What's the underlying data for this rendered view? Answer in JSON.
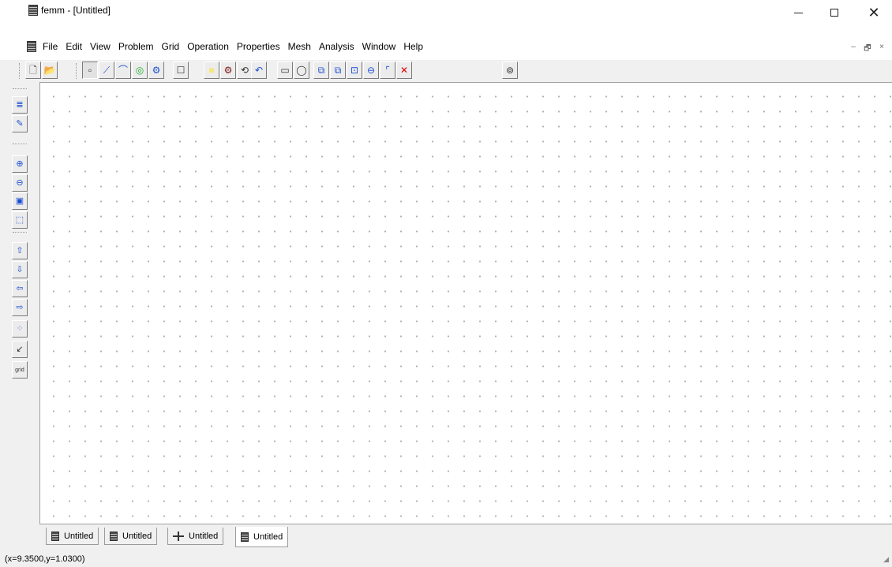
{
  "window": {
    "title": "femm - [Untitled]"
  },
  "titlebar": {
    "minimize": "−",
    "maximize": "□",
    "close": "✕"
  },
  "menu": {
    "items": [
      "File",
      "Edit",
      "View",
      "Problem",
      "Grid",
      "Operation",
      "Properties",
      "Mesh",
      "Analysis",
      "Window",
      "Help"
    ],
    "mdi_controls": [
      "–",
      "🗗",
      "×"
    ]
  },
  "toolbar": {
    "buttons": [
      {
        "name": "new-file-icon",
        "glyph": "🗋",
        "color": "#333333"
      },
      {
        "name": "open-folder-icon",
        "glyph": "📂",
        "color": "#b08000"
      },
      {
        "name": "node-mode-icon",
        "glyph": "▫",
        "color": "#333333",
        "pressed": true
      },
      {
        "name": "segment-mode-icon",
        "glyph": "⟋",
        "color": "#1c4fd0"
      },
      {
        "name": "arc-mode-icon",
        "glyph": "⌒",
        "color": "#1c4fd0"
      },
      {
        "name": "block-label-mode-icon",
        "glyph": "◎",
        "color": "#20b030"
      },
      {
        "name": "group-mode-icon",
        "glyph": "⚙",
        "color": "#1c4fd0"
      },
      {
        "name": "properties-icon",
        "glyph": "☐",
        "color": "#333333"
      },
      {
        "name": "highlight-icon",
        "glyph": "■",
        "color": "#f6e87a"
      },
      {
        "name": "materials-icon",
        "glyph": "⚙",
        "color": "#7a1010"
      },
      {
        "name": "boundary-icon",
        "glyph": "⟲",
        "color": "#333333"
      },
      {
        "name": "undo-icon",
        "glyph": "↶",
        "color": "#1c4fd0"
      },
      {
        "name": "select-rect-icon",
        "glyph": "▭",
        "color": "#333333"
      },
      {
        "name": "select-circle-icon",
        "glyph": "◯",
        "color": "#333333"
      },
      {
        "name": "copy-icon",
        "glyph": "⧉",
        "color": "#1c4fd0"
      },
      {
        "name": "move-icon",
        "glyph": "⧉",
        "color": "#1c4fd0"
      },
      {
        "name": "scale-icon",
        "glyph": "⊡",
        "color": "#1c4fd0"
      },
      {
        "name": "mirror-icon",
        "glyph": "⊖",
        "color": "#1c4fd0"
      },
      {
        "name": "fillet-icon",
        "glyph": "⌜",
        "color": "#1c4fd0"
      },
      {
        "name": "delete-icon",
        "glyph": "✕",
        "color": "#e00000"
      },
      {
        "name": "mesh-icon",
        "glyph": "⊚",
        "color": "#333333"
      }
    ]
  },
  "left_toolbar": {
    "buttons": [
      {
        "name": "sort-icon",
        "glyph": "≣",
        "color": "#1c4fd0"
      },
      {
        "name": "edit-icon",
        "glyph": "✎",
        "color": "#1c4fd0"
      },
      {
        "name": "zoom-in-icon",
        "glyph": "⊕",
        "color": "#1c4fd0"
      },
      {
        "name": "zoom-out-icon",
        "glyph": "⊖",
        "color": "#1c4fd0"
      },
      {
        "name": "zoom-natural-icon",
        "glyph": "▣",
        "color": "#1c4fd0"
      },
      {
        "name": "zoom-window-icon",
        "glyph": "⬚",
        "color": "#1c4fd0"
      },
      {
        "name": "pan-up-icon",
        "glyph": "⇧",
        "color": "#1c4fd0"
      },
      {
        "name": "pan-down-icon",
        "glyph": "⇩",
        "color": "#1c4fd0"
      },
      {
        "name": "pan-left-icon",
        "glyph": "⇦",
        "color": "#1c4fd0"
      },
      {
        "name": "pan-right-icon",
        "glyph": "⇨",
        "color": "#1c4fd0"
      },
      {
        "name": "show-grid-icon",
        "glyph": "⁘",
        "color": "#6080c0"
      },
      {
        "name": "snap-grid-icon",
        "glyph": "↙",
        "color": "#333333"
      },
      {
        "name": "grid-size-icon",
        "glyph": "grid",
        "color": "#333333"
      }
    ]
  },
  "tabs": [
    {
      "label": "Untitled",
      "icon": "femm-icon"
    },
    {
      "label": "Untitled",
      "icon": "femm-icon"
    },
    {
      "label": "Untitled",
      "icon": "cross-icon"
    },
    {
      "label": "Untitled",
      "icon": "femm-icon",
      "active": true
    }
  ],
  "status": {
    "text": "(x=9.3500,y=1.0300)"
  }
}
